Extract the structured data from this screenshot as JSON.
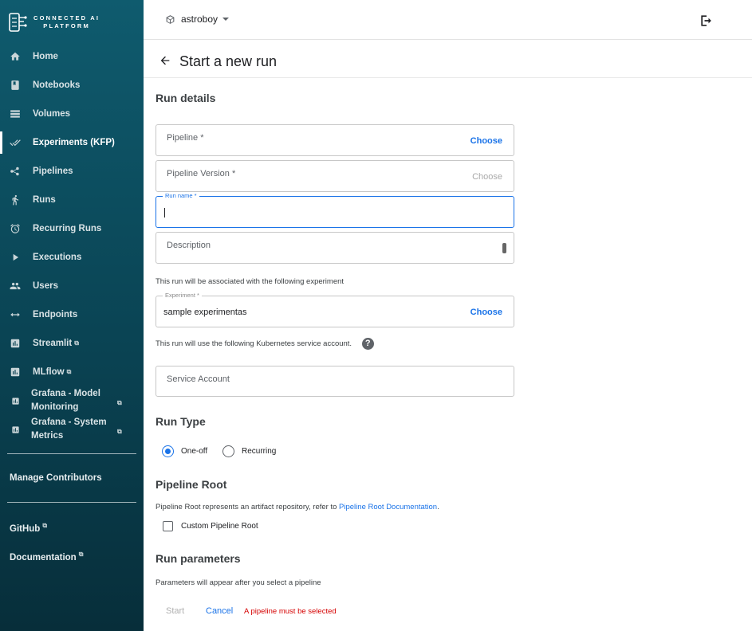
{
  "brand": {
    "line1": "CONNECTED AI",
    "line2": "PLATFORM"
  },
  "sidebar": {
    "items": [
      {
        "label": "Home",
        "icon": "home-icon"
      },
      {
        "label": "Notebooks",
        "icon": "notebook-icon"
      },
      {
        "label": "Volumes",
        "icon": "volumes-icon"
      },
      {
        "label": "Experiments (KFP)",
        "icon": "double-check-icon",
        "active": true
      },
      {
        "label": "Pipelines",
        "icon": "pipeline-icon"
      },
      {
        "label": "Runs",
        "icon": "runner-icon"
      },
      {
        "label": "Recurring Runs",
        "icon": "alarm-icon"
      },
      {
        "label": "Executions",
        "icon": "play-icon"
      },
      {
        "label": "Users",
        "icon": "users-icon"
      },
      {
        "label": "Endpoints",
        "icon": "arrows-icon"
      },
      {
        "label": "Streamlit",
        "icon": "chart-icon",
        "external": true
      },
      {
        "label": "MLflow",
        "icon": "chart-icon",
        "external": true
      },
      {
        "label": "Grafana - Model Monitoring",
        "icon": "chart-icon",
        "external": true
      },
      {
        "label": "Grafana - System Metrics",
        "icon": "chart-icon",
        "external": true
      }
    ],
    "manage_contributors": "Manage Contributors",
    "github": "GitHub",
    "documentation": "Documentation",
    "external_mark": "⧉"
  },
  "topbar": {
    "namespace": "astroboy"
  },
  "header": {
    "title": "Start a new run"
  },
  "run_details": {
    "heading": "Run details",
    "pipeline": {
      "placeholder": "Pipeline *",
      "choose": "Choose"
    },
    "pipeline_version": {
      "placeholder": "Pipeline Version *",
      "choose": "Choose"
    },
    "run_name": {
      "label": "Run name *",
      "value": ""
    },
    "description": {
      "placeholder": "Description"
    },
    "experiment_note": "This run will be associated with the following experiment",
    "experiment": {
      "label": "Experiment *",
      "value": "sample experimentas",
      "choose": "Choose"
    },
    "service_account_note": "This run will use the following Kubernetes service account.",
    "help_glyph": "?",
    "service_account": {
      "placeholder": "Service Account"
    }
  },
  "run_type": {
    "heading": "Run Type",
    "options": [
      {
        "label": "One-off",
        "selected": true
      },
      {
        "label": "Recurring",
        "selected": false
      }
    ]
  },
  "pipeline_root": {
    "heading": "Pipeline Root",
    "note": "Pipeline Root represents an artifact repository, refer to",
    "link": "Pipeline Root Documentation",
    "period": ".",
    "checkbox": "Custom Pipeline Root"
  },
  "run_parameters": {
    "heading": "Run parameters",
    "note": "Parameters will appear after you select a pipeline"
  },
  "actions": {
    "start": "Start",
    "cancel": "Cancel",
    "error": "A pipeline must be selected"
  },
  "colors": {
    "accent": "#1a73e8",
    "sidebar": "#0a4353",
    "error": "#d50000"
  }
}
